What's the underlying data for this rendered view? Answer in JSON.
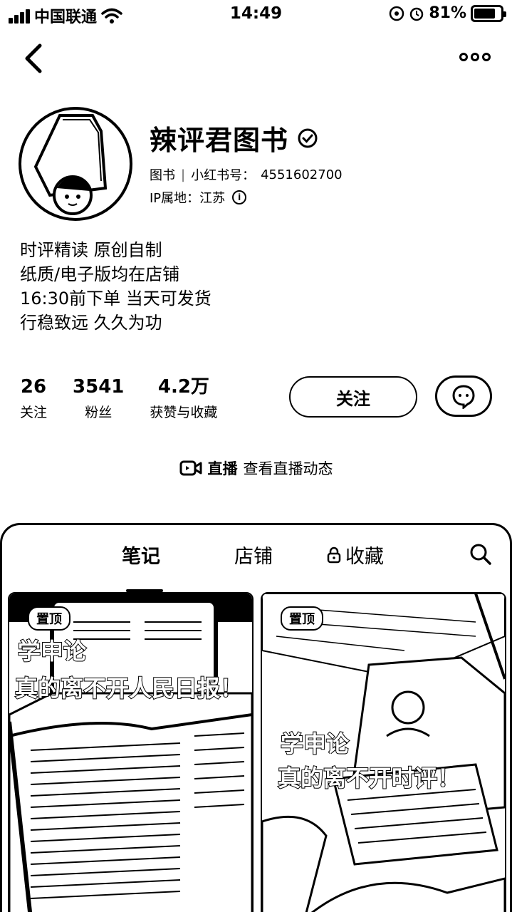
{
  "status_bar": {
    "carrier": "中国联通",
    "time": "14:49",
    "battery": "81%",
    "battery_level": 0.81
  },
  "profile": {
    "name": "辣评君图书",
    "category": "图书",
    "id_label": "小红书号：",
    "id_value": "4551602700",
    "ip_label": "IP属地：江苏",
    "bio": [
      "时评精读 原创自制",
      "纸质/电子版均在店铺",
      "16:30前下单 当天可发货",
      "行稳致远 久久为功"
    ]
  },
  "stats": [
    {
      "value": "26",
      "label": "关注"
    },
    {
      "value": "3541",
      "label": "粉丝"
    },
    {
      "value": "4.2万",
      "label": "获赞与收藏"
    }
  ],
  "actions": {
    "follow": "关注"
  },
  "live": {
    "label": "直播",
    "link": "查看直播动态"
  },
  "tabs": {
    "notes": "笔记",
    "shop": "店铺",
    "collect": "收藏"
  },
  "cards": [
    {
      "badge": "置顶",
      "title_line1": "学申论",
      "title_line2": "真的离不开人民日报！"
    },
    {
      "badge": "置顶",
      "title_line1": "学申论",
      "title_line2": "真的离不开时评！"
    }
  ]
}
